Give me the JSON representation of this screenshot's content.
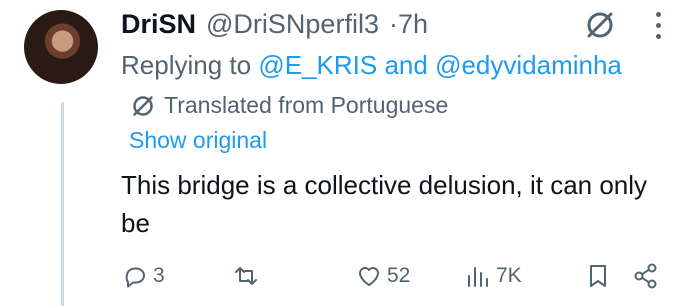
{
  "tweet": {
    "display_name": "DriSN",
    "handle": "@DriSNperfil3",
    "separator": "·",
    "time": "7h",
    "replying_prefix": "Replying to",
    "mention_1": "@E_KRIS",
    "mention_joiner": "and",
    "mention_2": "@edyvidaminha",
    "translated_label": "Translated from Portuguese",
    "show_original": "Show original",
    "text": "This bridge is a collective delusion, it can only be"
  },
  "actions": {
    "replies": "3",
    "retweets": "",
    "likes": "52",
    "views": "7K"
  },
  "icons": {
    "grok": "grok-icon",
    "more": "more-icon",
    "reply": "reply-icon",
    "retweet": "retweet-icon",
    "like": "heart-icon",
    "views": "views-icon",
    "bookmark": "bookmark-icon",
    "share": "share-icon"
  },
  "colors": {
    "accent": "#1d9bf0",
    "secondary_text": "#536471",
    "primary_text": "#0f1419",
    "thread_line": "#cfd9de"
  }
}
